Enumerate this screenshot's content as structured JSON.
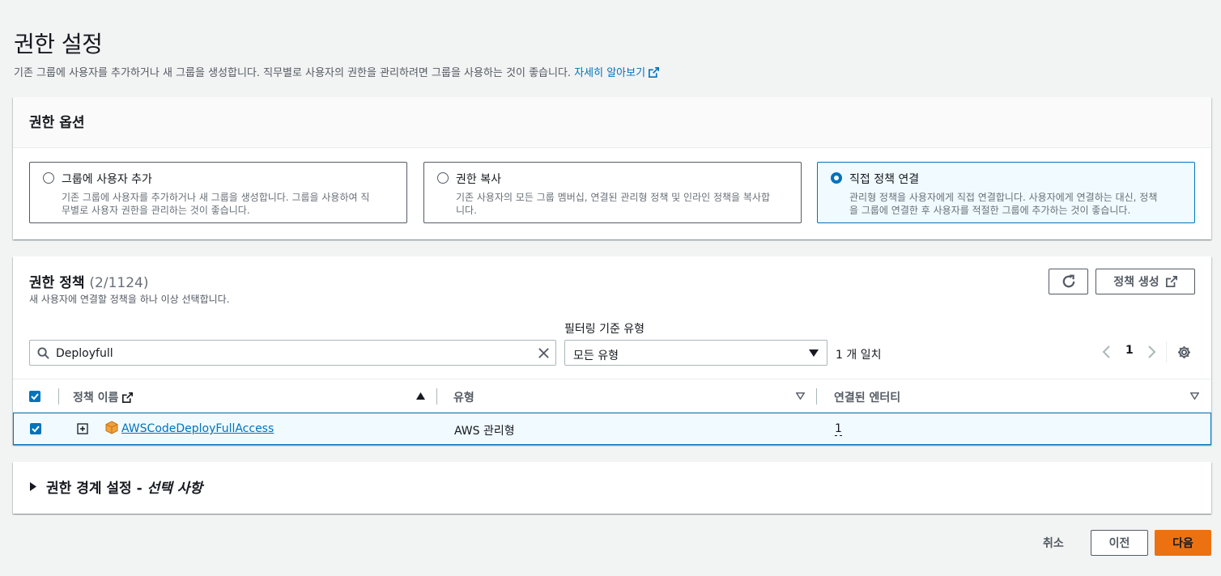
{
  "page": {
    "title": "권한 설정",
    "description": "기존 그룹에 사용자를 추가하거나 새 그룹을 생성합니다. 직무별로 사용자의 권한을 관리하려면 그룹을 사용하는 것이 좋습니다.",
    "learn_more": "자세히 알아보기"
  },
  "options": {
    "header": "권한 옵션",
    "items": [
      {
        "title": "그룹에 사용자 추가",
        "desc1": "기존 그룹에 사용자를 추가하거나 새 그룹을 생성합니다. 그룹을 사용하여 직",
        "desc2": "무별로 사용자 권한을 관리하는 것이 좋습니다.",
        "selected": false
      },
      {
        "title": "권한 복사",
        "desc1": "기존 사용자의 모든 그룹 멤버십, 연결된 관리형 정책 및 인라인 정책을 복사합",
        "desc2": "니다.",
        "selected": false
      },
      {
        "title": "직접 정책 연결",
        "desc1": "관리형 정책을 사용자에게 직접 연결합니다. 사용자에게 연결하는 대신, 정책",
        "desc2": "을 그룹에 연결한 후 사용자를 적절한 그룹에 추가하는 것이 좋습니다.",
        "selected": true
      }
    ]
  },
  "policies": {
    "title": "권한 정책",
    "count": "(2/1124)",
    "subtitle": "새 사용자에 연결할 정책을 하나 이상 선택합니다.",
    "create_label": "정책 생성",
    "filter_label": "필터링 기준 유형",
    "search_value": "Deployfull",
    "filter_value": "모든 유형",
    "match_text": "1 개 일치",
    "page_number": "1",
    "columns": {
      "name": "정책 이름",
      "type": "유형",
      "entities": "연결된 엔터티"
    },
    "rows": [
      {
        "name": "AWSCodeDeployFullAccess",
        "type": "AWS 관리형",
        "entities": "1",
        "checked": true
      }
    ]
  },
  "boundary": {
    "title": "권한 경계 설정 - ",
    "title_optional": "선택 사항"
  },
  "footer": {
    "cancel": "취소",
    "previous": "이전",
    "next": "다음"
  },
  "colors": {
    "accent": "#0073bb",
    "primary_button": "#ec7211"
  }
}
